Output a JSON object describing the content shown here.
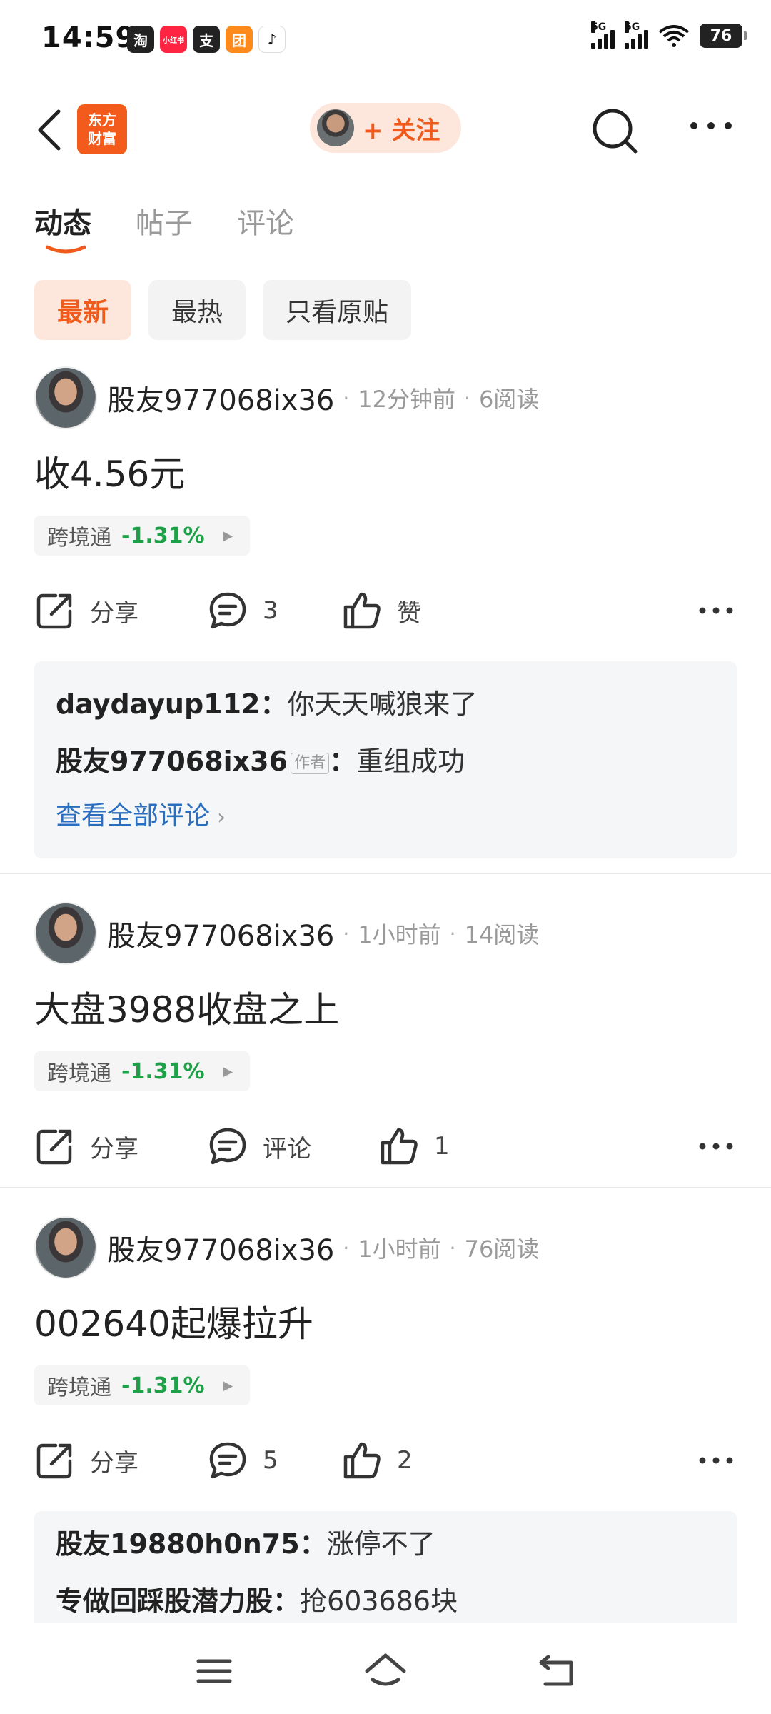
{
  "status_bar": {
    "time": "14:59",
    "apps": [
      {
        "icon": "taobao-icon",
        "glyph": "淘",
        "color": "#222222"
      },
      {
        "icon": "xiaohongshu-icon",
        "glyph": "小红书",
        "color": "#ff2442"
      },
      {
        "icon": "alipay-icon",
        "glyph": "支",
        "color": "#222222"
      },
      {
        "icon": "meituan-icon",
        "glyph": "团",
        "color": "#ff8a1c"
      },
      {
        "icon": "tiktok-icon",
        "glyph": "♪",
        "color": "#111111"
      }
    ],
    "network_1": "5G",
    "network_2": "5G",
    "battery": "76"
  },
  "header": {
    "logo_text_1": "东方",
    "logo_text_2": "财富",
    "follow_label": "+ 关注"
  },
  "tabs": [
    {
      "label": "动态",
      "active": true
    },
    {
      "label": "帖子",
      "active": false
    },
    {
      "label": "评论",
      "active": false
    }
  ],
  "filters": [
    {
      "label": "最新",
      "active": true
    },
    {
      "label": "最热",
      "active": false
    },
    {
      "label": "只看原贴",
      "active": false
    }
  ],
  "posts": [
    {
      "user": "股友977068ix36",
      "time": "12分钟前",
      "reads": "6阅读",
      "content": "收4.56元",
      "stock": {
        "name": "跨境通",
        "change": "-1.31%"
      },
      "share_label": "分享",
      "comment_label": "3",
      "like_label": "赞",
      "comments": [
        {
          "user": "daydayup112",
          "sep": "：",
          "text": "你天天喊狼来了",
          "is_author": false
        },
        {
          "user": "股友977068ix36",
          "author_tag": "作者",
          "sep": "：",
          "text": "重组成功",
          "is_author": true
        }
      ],
      "view_all": "查看全部评论"
    },
    {
      "user": "股友977068ix36",
      "time": "1小时前",
      "reads": "14阅读",
      "content": "大盘3988收盘之上",
      "stock": {
        "name": "跨境通",
        "change": "-1.31%"
      },
      "share_label": "分享",
      "comment_label": "评论",
      "like_label": "1"
    },
    {
      "user": "股友977068ix36",
      "time": "1小时前",
      "reads": "76阅读",
      "content": "002640起爆拉升",
      "stock": {
        "name": "跨境通",
        "change": "-1.31%"
      },
      "share_label": "分享",
      "comment_label": "5",
      "like_label": "2",
      "comments": [
        {
          "user": "股友19880h0n75",
          "sep": "：",
          "text": "涨停不了"
        },
        {
          "user": "专做回踩股潜力股",
          "sep": "：",
          "text": "抢603686块"
        }
      ]
    }
  ],
  "colors": {
    "accent": "#f05b1b",
    "stock_down": "#1da047",
    "link": "#2a6fbf"
  }
}
